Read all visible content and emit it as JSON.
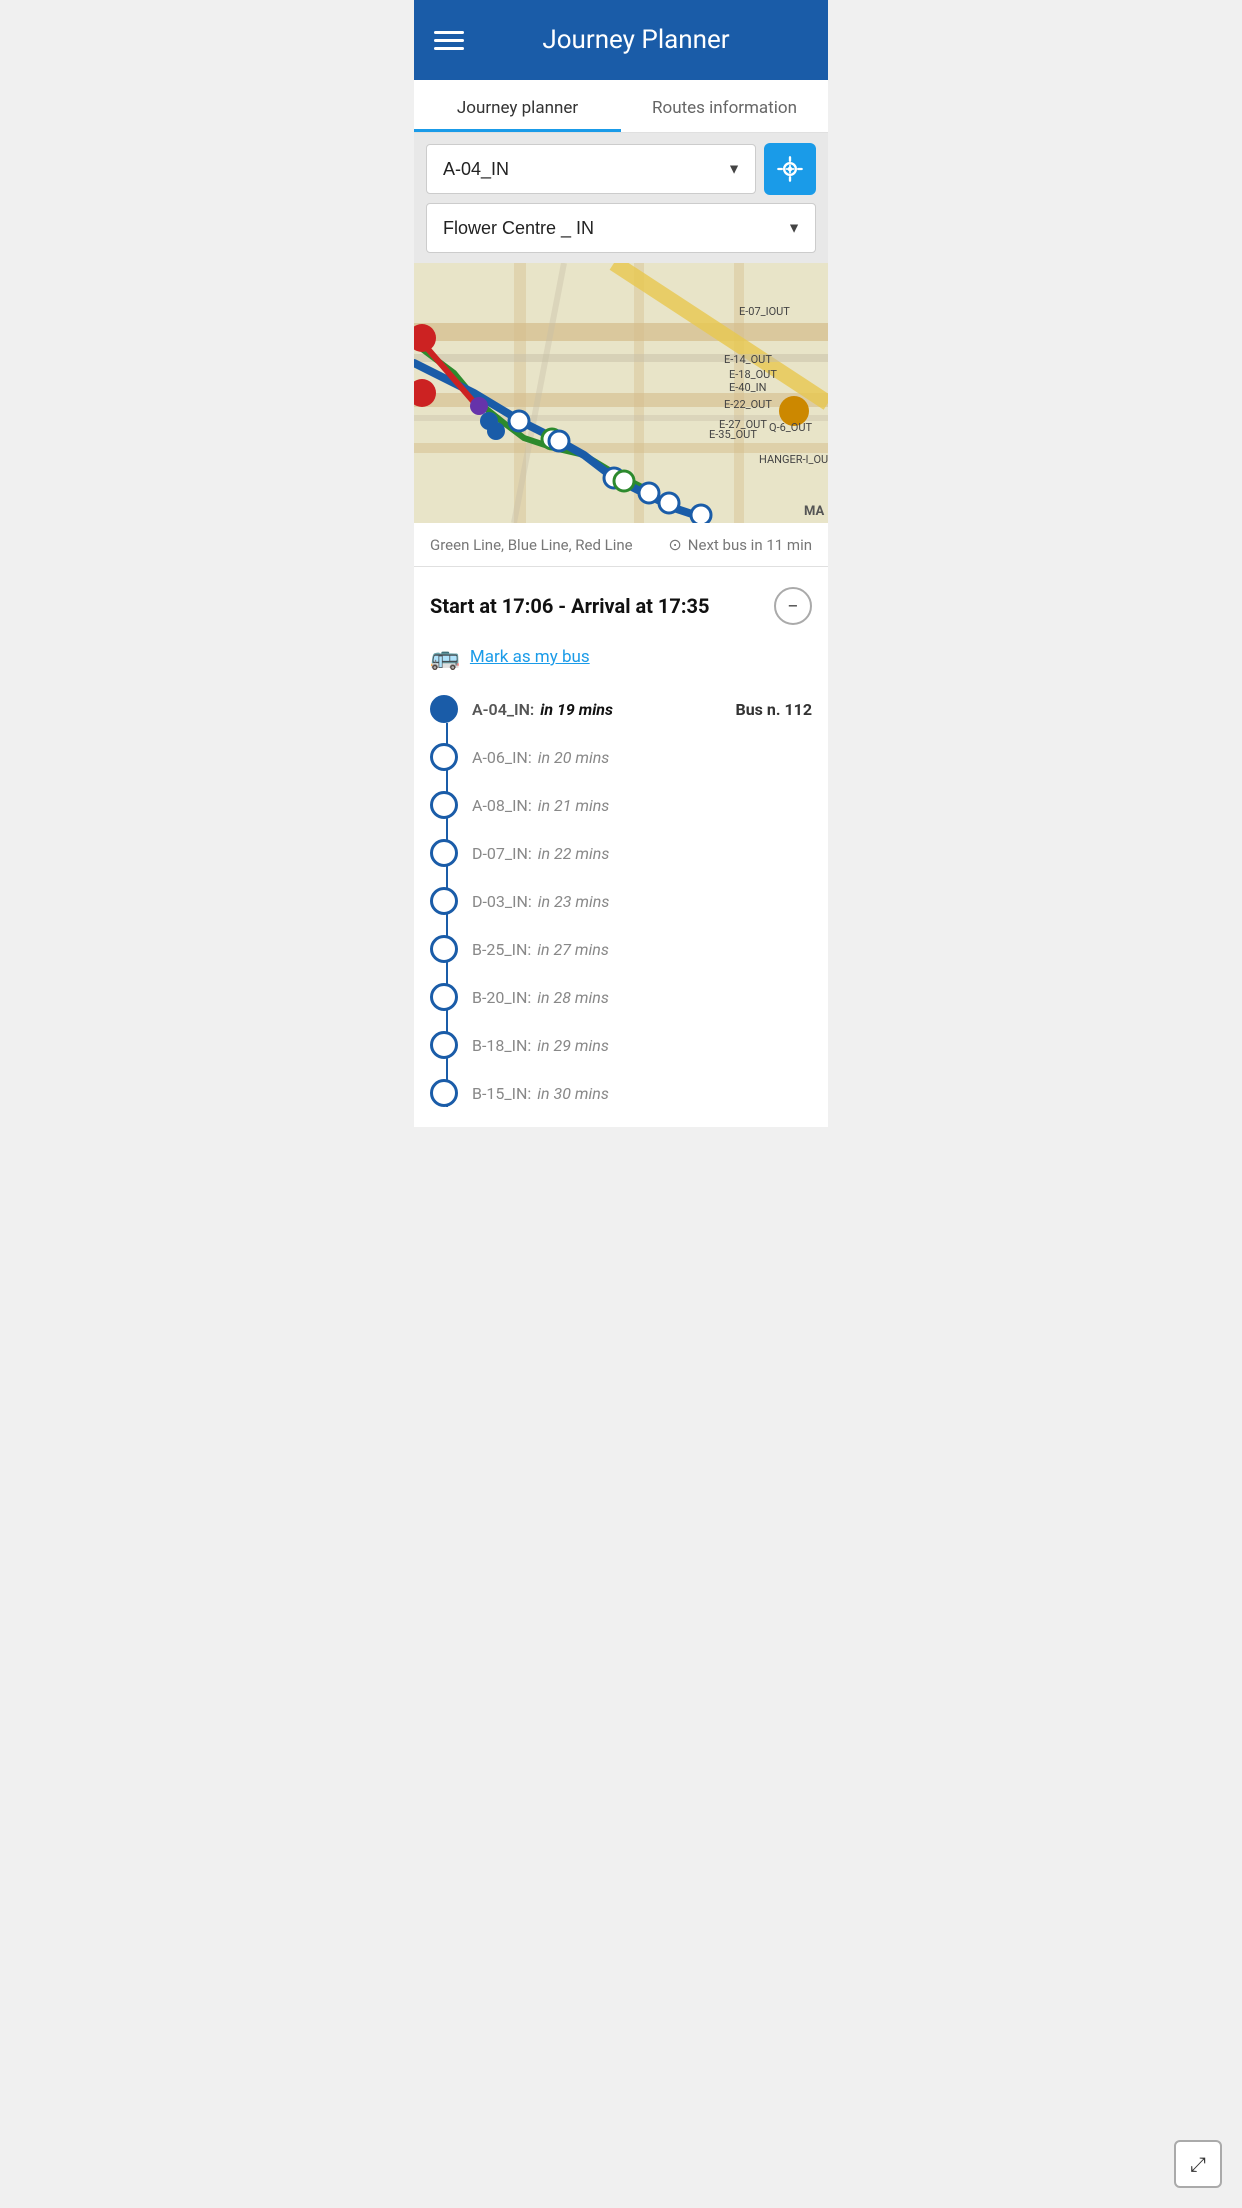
{
  "header": {
    "title": "Journey Planner"
  },
  "tabs": [
    {
      "id": "journey-planner",
      "label": "Journey planner",
      "active": true
    },
    {
      "id": "routes-information",
      "label": "Routes information",
      "active": false
    }
  ],
  "controls": {
    "from_value": "A-04_IN",
    "to_value": "Flower Centre _ IN",
    "locate_label": "Locate"
  },
  "map": {
    "lines_label": "Green Line, Blue Line, Red Line",
    "next_bus_label": "Next bus in 11 min"
  },
  "journey": {
    "title": "Start at 17:06 - Arrival at 17:35",
    "mark_bus_label": "Mark as my bus",
    "stops": [
      {
        "id": "A-04_IN",
        "name": "A-04_IN:",
        "time": "in 19 mins",
        "bus": "Bus n. 112",
        "highlight": true,
        "filled": true
      },
      {
        "id": "A-06_IN",
        "name": "A-06_IN:",
        "time": "in 20 mins",
        "bus": "",
        "highlight": false,
        "filled": false
      },
      {
        "id": "A-08_IN",
        "name": "A-08_IN:",
        "time": "in 21 mins",
        "bus": "",
        "highlight": false,
        "filled": false
      },
      {
        "id": "D-07_IN",
        "name": "D-07_IN:",
        "time": "in 22 mins",
        "bus": "",
        "highlight": false,
        "filled": false
      },
      {
        "id": "D-03_IN",
        "name": "D-03_IN:",
        "time": "in 23 mins",
        "bus": "",
        "highlight": false,
        "filled": false
      },
      {
        "id": "B-25_IN",
        "name": "B-25_IN:",
        "time": "in 27 mins",
        "bus": "",
        "highlight": false,
        "filled": false
      },
      {
        "id": "B-20_IN",
        "name": "B-20_IN:",
        "time": "in 28 mins",
        "bus": "",
        "highlight": false,
        "filled": false
      },
      {
        "id": "B-18_IN",
        "name": "B-18_IN:",
        "time": "in 29 mins",
        "bus": "",
        "highlight": false,
        "filled": false
      },
      {
        "id": "B-15_IN",
        "name": "B-15_IN:",
        "time": "in 30 mins",
        "bus": "",
        "highlight": false,
        "filled": false
      }
    ]
  }
}
